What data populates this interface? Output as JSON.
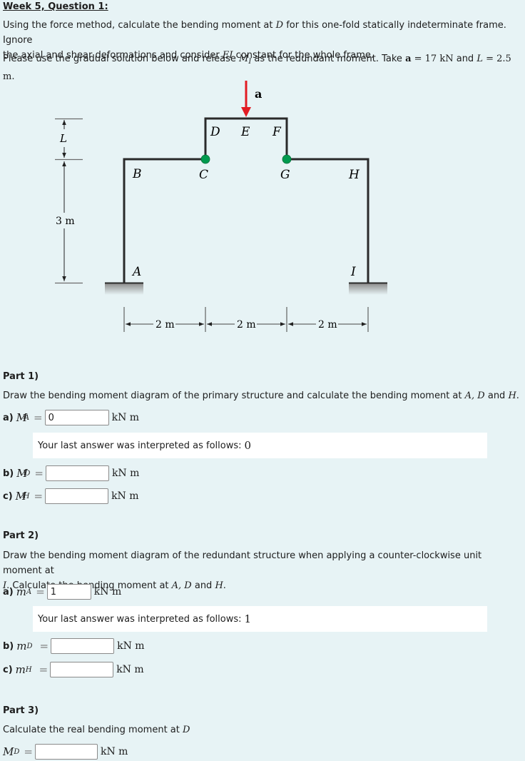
{
  "header": {
    "title": "Week 5, Question 1:"
  },
  "intro": {
    "line1_pre": "Using the force method, calculate the bending moment at ",
    "line1_var": "D",
    "line1_post": " for this one-fold statically indeterminate frame. Ignore",
    "line2_pre": "the axial and shear deformations and consider ",
    "line2_var": "EI",
    "line2_post": " constant for the whole frame.",
    "line3_pre": "Please use the gradual solution below and release ",
    "line3_var": "M",
    "line3_sub": "I",
    "line3_mid": " as the redundant moment. Take ",
    "load_symbol": "a",
    "load_value": " = 17 kN",
    "line3_and": " and ",
    "length_symbol": "L",
    "length_value": " = 2.5 m."
  },
  "diagram": {
    "load_label": "a",
    "node_labels": [
      "A",
      "B",
      "C",
      "D",
      "E",
      "F",
      "G",
      "H",
      "I"
    ],
    "dim_left_L": "L",
    "dim_left_3m": "3 m",
    "dim_bottom": [
      "2 m",
      "2 m",
      "2 m"
    ],
    "colors": {
      "frame": "#2a2a2a",
      "load": "#e21b23",
      "hinge": "#009a4e"
    }
  },
  "part1": {
    "heading": "Part 1)",
    "desc_pre": "Draw the bending moment diagram of the primary structure and calculate the bending moment at ",
    "desc_vars": "A, D",
    "desc_and": " and ",
    "desc_last": "H",
    "desc_end": ".",
    "items": [
      {
        "label": "a)",
        "symbol": "M",
        "sup": "1",
        "sub": "A",
        "value": "0",
        "unit": "kN m"
      },
      {
        "label": "b)",
        "symbol": "M",
        "sup": "1",
        "sub": "D",
        "value": "",
        "unit": "kN m"
      },
      {
        "label": "c)",
        "symbol": "M",
        "sup": "1",
        "sub": "H",
        "value": "",
        "unit": "kN m"
      }
    ],
    "feedback_text": "Your last answer was interpreted as follows:",
    "feedback_value": "0"
  },
  "part2": {
    "heading": "Part 2)",
    "desc_line1": "Draw the bending moment diagram of the redundant structure when applying a counter-clockwise unit moment at",
    "desc_var_I": "I",
    "desc_line2": ". Calculate the bending moment at ",
    "desc_vars": "A, D",
    "desc_and": " and ",
    "desc_last": "H",
    "desc_end": ".",
    "items": [
      {
        "label": "a)",
        "symbol": "m",
        "sub": "A",
        "value": "1",
        "unit": "kN m"
      },
      {
        "label": "b)",
        "symbol": "m",
        "sub": "D",
        "value": "",
        "unit": "kN m"
      },
      {
        "label": "c)",
        "symbol": "m",
        "sub": "H",
        "value": "",
        "unit": "kN m"
      }
    ],
    "feedback_text": "Your last answer was interpreted as follows:",
    "feedback_value": "1"
  },
  "part3": {
    "heading": "Part 3)",
    "desc_pre": "Calculate the real bending moment at ",
    "desc_var": "D",
    "item": {
      "symbol": "M",
      "sub": "D",
      "value": "",
      "unit": "kN m"
    }
  }
}
